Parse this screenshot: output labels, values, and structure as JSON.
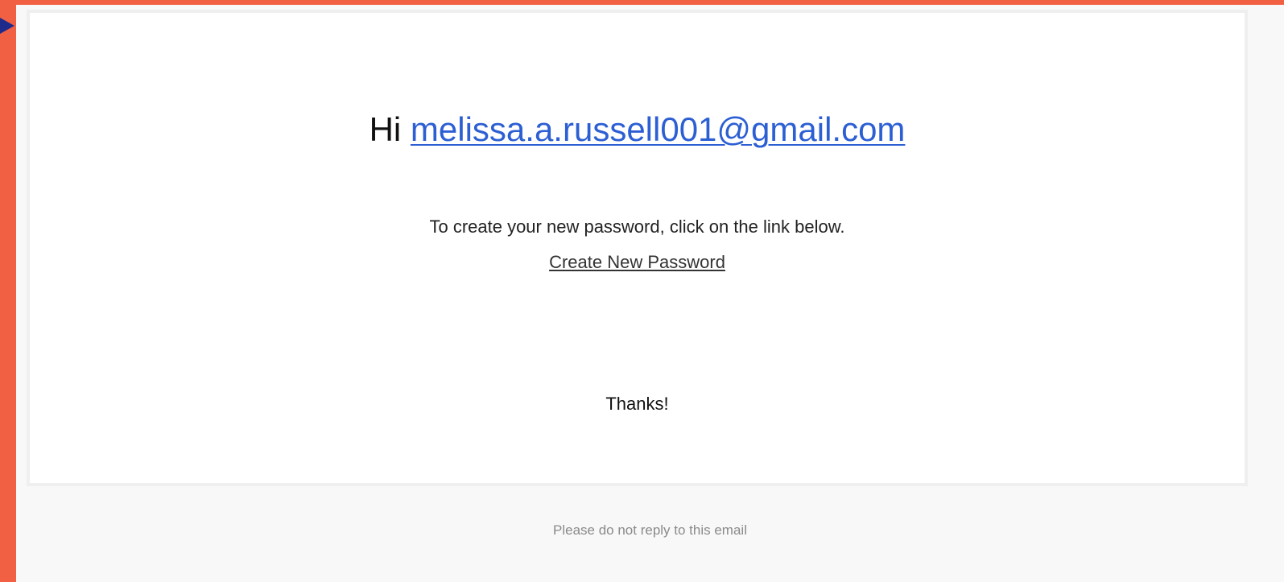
{
  "colors": {
    "outer_background": "#f26044",
    "canvas_background": "#f8f8f8",
    "card_background": "#ffffff",
    "email_link": "#2c5fd3",
    "footer_text": "#8a8a8a",
    "arrow": "#1f2b8a"
  },
  "email": {
    "greeting_prefix": "Hi",
    "recipient_email": "melissa.a.russell001@gmail.com",
    "instruction": "To create your new password, click on the link below.",
    "create_password_link": "Create New Password",
    "thanks": "Thanks!",
    "footer_note": "Please do not reply to this email"
  },
  "icons": {
    "corner_marker": "arrow-right-icon"
  }
}
